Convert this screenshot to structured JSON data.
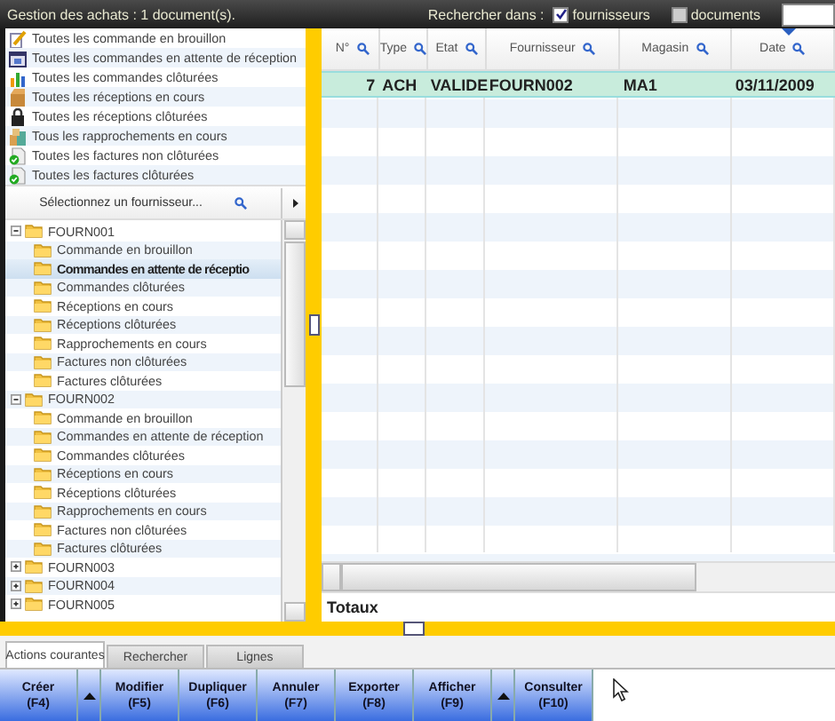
{
  "header": {
    "title": "Gestion des achats : 1 document(s).",
    "search_label": "Rechercher dans :",
    "search_options": [
      {
        "label": "fournisseurs",
        "checked": true
      },
      {
        "label": "documents",
        "checked": false
      }
    ]
  },
  "quick_list": [
    {
      "label": "Toutes les commande en brouillon",
      "kind": "draft"
    },
    {
      "label": "Toutes les commandes en attente de réception",
      "kind": "calendar"
    },
    {
      "label": "Toutes les commandes clôturées",
      "kind": "chart"
    },
    {
      "label": "Toutes les réceptions en cours",
      "kind": "box"
    },
    {
      "label": "Toutes les réceptions clôturées",
      "kind": "lock"
    },
    {
      "label": "Tous les rapprochements en cours",
      "kind": "boxes"
    },
    {
      "label": "Toutes les factures non clôturées",
      "kind": "invoice"
    },
    {
      "label": "Toutes les factures clôturées",
      "kind": "invoice"
    }
  ],
  "supplier_selector": {
    "placeholder": "Sélectionnez un fournisseur..."
  },
  "tree": [
    {
      "label": "FOURN001",
      "expanded": true,
      "selected": false,
      "children": [
        {
          "label": "Commande en brouillon",
          "selected": false
        },
        {
          "label": "Commandes en attente de réceptio",
          "selected": true
        },
        {
          "label": "Commandes clôturées",
          "selected": false
        },
        {
          "label": "Réceptions en cours",
          "selected": false
        },
        {
          "label": "Réceptions clôturées",
          "selected": false
        },
        {
          "label": "Rapprochements en cours",
          "selected": false
        },
        {
          "label": "Factures non clôturées",
          "selected": false
        },
        {
          "label": "Factures clôturées",
          "selected": false
        }
      ]
    },
    {
      "label": "FOURN002",
      "expanded": true,
      "selected": false,
      "children": [
        {
          "label": "Commande en brouillon",
          "selected": false
        },
        {
          "label": "Commandes en attente de réception",
          "selected": false
        },
        {
          "label": "Commandes clôturées",
          "selected": false
        },
        {
          "label": "Réceptions en cours",
          "selected": false
        },
        {
          "label": "Réceptions clôturées",
          "selected": false
        },
        {
          "label": "Rapprochements en cours",
          "selected": false
        },
        {
          "label": "Factures non clôturées",
          "selected": false
        },
        {
          "label": "Factures clôturées",
          "selected": false
        }
      ]
    },
    {
      "label": "FOURN003",
      "expanded": false,
      "selected": false
    },
    {
      "label": "FOURN004",
      "expanded": false,
      "selected": false
    },
    {
      "label": "FOURN005",
      "expanded": false,
      "selected": false
    }
  ],
  "grid": {
    "columns": [
      {
        "label": "N°",
        "sorted": false
      },
      {
        "label": "Type",
        "sorted": false
      },
      {
        "label": "Etat",
        "sorted": false
      },
      {
        "label": "Fournisseur",
        "sorted": false
      },
      {
        "label": "Magasin",
        "sorted": false
      },
      {
        "label": "Date",
        "sorted": true
      }
    ],
    "rows": [
      {
        "cells": [
          "7",
          "ACH",
          "VALIDE",
          "FOURN002",
          "MA1",
          "03/11/2009"
        ],
        "selected": true
      }
    ],
    "totals_label": "Totaux"
  },
  "tabs": [
    {
      "label": "Actions courantes",
      "selected": true
    },
    {
      "label": "Rechercher",
      "selected": false
    },
    {
      "label": "Lignes",
      "selected": false
    }
  ],
  "actions": [
    {
      "kind": "button",
      "label": "Créer",
      "key": "(F4)"
    },
    {
      "kind": "menu"
    },
    {
      "kind": "button",
      "label": "Modifier",
      "key": "(F5)"
    },
    {
      "kind": "button",
      "label": "Dupliquer",
      "key": "(F6)"
    },
    {
      "kind": "button",
      "label": "Annuler",
      "key": "(F7)"
    },
    {
      "kind": "button",
      "label": "Exporter",
      "key": "(F8)"
    },
    {
      "kind": "button",
      "label": "Afficher",
      "key": "(F9)"
    },
    {
      "kind": "menu"
    },
    {
      "kind": "button",
      "label": "Consulter",
      "key": "(F10)"
    }
  ]
}
